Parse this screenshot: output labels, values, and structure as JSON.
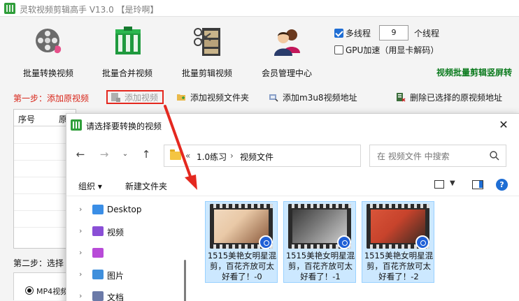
{
  "app": {
    "title": "灵软视频剪辑高手 V13.0 【是玲啊】"
  },
  "toolbar": {
    "buttons": [
      {
        "label": "批量转换视频",
        "icon": "film-reel-icon"
      },
      {
        "label": "批量合并视频",
        "icon": "merge-blocks-icon"
      },
      {
        "label": "批量剪辑视频",
        "icon": "scissors-film-icon"
      },
      {
        "label": "会员管理中心",
        "icon": "users-icon"
      }
    ],
    "multithread_label": "多线程",
    "thread_count": "9",
    "thread_unit": "个线程",
    "gpu_label": "GPU加速（用显卡解码）",
    "promo": "视频批量剪辑竖屏转"
  },
  "step1": {
    "label": "第一步：添加原视频",
    "add_video": "添加视频",
    "add_folder": "添加视频文件夹",
    "add_m3u8": "添加m3u8视频地址",
    "delete_selected": "删除已选择的原视频地址"
  },
  "list": {
    "col_index": "序号",
    "col_name": "原"
  },
  "step2": {
    "label": "第二步：选择",
    "format": "MP4视频"
  },
  "dialog": {
    "title": "请选择要转换的视频",
    "close": "✕",
    "breadcrumb": [
      "1.0练习",
      "视频文件"
    ],
    "search_placeholder": "在 视频文件 中搜索",
    "organize": "组织 ▾",
    "new_folder": "新建文件夹",
    "nav_items": [
      {
        "label": "Desktop",
        "color": "#3a8ee6"
      },
      {
        "label": "视频",
        "color": "#8a4fd6"
      },
      {
        "label": "",
        "color": "#b84bd8"
      },
      {
        "label": "图片",
        "color": "#3f8fdc"
      },
      {
        "label": "文档",
        "color": "#6b7aa8"
      }
    ],
    "files": [
      {
        "name": "1515美艳女明星混剪，百花齐放可太好看了！-0",
        "palette": [
          "#e9c9a7",
          "#8b5a3c"
        ]
      },
      {
        "name": "1515美艳女明星混剪，百花齐放可太好看了！-1",
        "palette": [
          "#5e5e5e",
          "#cfcfcf"
        ]
      },
      {
        "name": "1515美艳女明星混剪，百花齐放可太好看了！-2",
        "palette": [
          "#c7432c",
          "#3b2a22"
        ]
      }
    ]
  },
  "colors": {
    "accent": "#1f6ed4",
    "highlight_red": "#e4281f",
    "step_red": "#d8261a",
    "promo_green": "#0a7a1d",
    "tile_selected": "#cce8ff"
  }
}
